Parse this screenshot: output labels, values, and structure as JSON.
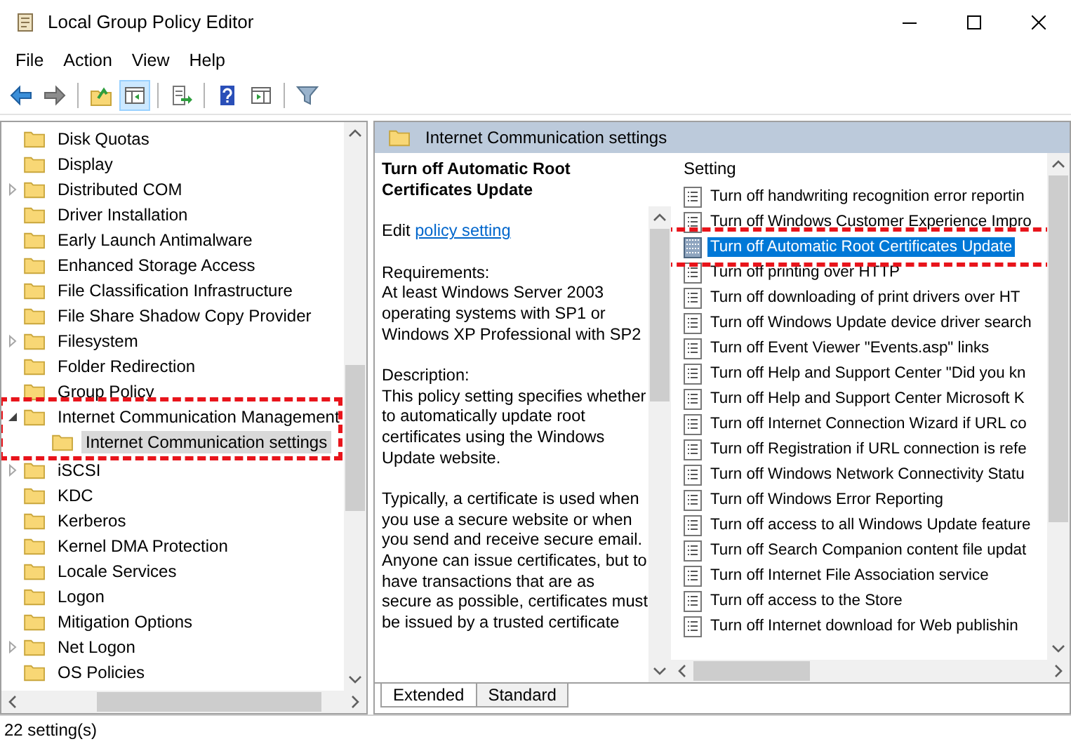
{
  "window": {
    "title": "Local Group Policy Editor"
  },
  "menu": [
    "File",
    "Action",
    "View",
    "Help"
  ],
  "toolbar": [
    {
      "kind": "back",
      "pressed": false
    },
    {
      "kind": "forward",
      "pressed": false
    },
    {
      "kind": "sep"
    },
    {
      "kind": "up",
      "pressed": false
    },
    {
      "kind": "tree",
      "pressed": true
    },
    {
      "kind": "sep"
    },
    {
      "kind": "export",
      "pressed": false
    },
    {
      "kind": "sep"
    },
    {
      "kind": "help",
      "pressed": false
    },
    {
      "kind": "pane",
      "pressed": false
    },
    {
      "kind": "sep"
    },
    {
      "kind": "filter",
      "pressed": false
    }
  ],
  "tree": {
    "items": [
      {
        "label": "Disk Quotas",
        "kind": "leaf",
        "selected": false,
        "highlighted": false
      },
      {
        "label": "Display",
        "kind": "leaf",
        "selected": false,
        "highlighted": false
      },
      {
        "label": "Distributed COM",
        "kind": "collapsed",
        "selected": false,
        "highlighted": false
      },
      {
        "label": "Driver Installation",
        "kind": "leaf",
        "selected": false,
        "highlighted": false
      },
      {
        "label": "Early Launch Antimalware",
        "kind": "leaf",
        "selected": false,
        "highlighted": false
      },
      {
        "label": "Enhanced Storage Access",
        "kind": "leaf",
        "selected": false,
        "highlighted": false
      },
      {
        "label": "File Classification Infrastructure",
        "kind": "leaf",
        "selected": false,
        "highlighted": false
      },
      {
        "label": "File Share Shadow Copy Provider",
        "kind": "leaf",
        "selected": false,
        "highlighted": false
      },
      {
        "label": "Filesystem",
        "kind": "collapsed",
        "selected": false,
        "highlighted": false
      },
      {
        "label": "Folder Redirection",
        "kind": "leaf",
        "selected": false,
        "highlighted": false
      },
      {
        "label": "Group Policy",
        "kind": "leaf",
        "selected": false,
        "highlighted": false
      },
      {
        "label": "Internet Communication Management",
        "kind": "expanded",
        "selected": false,
        "highlighted": true,
        "children": [
          {
            "label": "Internet Communication settings",
            "selected": true,
            "highlighted": false
          }
        ]
      },
      {
        "label": "iSCSI",
        "kind": "collapsed",
        "selected": false,
        "highlighted": false
      },
      {
        "label": "KDC",
        "kind": "leaf",
        "selected": false,
        "highlighted": false
      },
      {
        "label": "Kerberos",
        "kind": "leaf",
        "selected": false,
        "highlighted": false
      },
      {
        "label": "Kernel DMA Protection",
        "kind": "leaf",
        "selected": false,
        "highlighted": false
      },
      {
        "label": "Locale Services",
        "kind": "leaf",
        "selected": false,
        "highlighted": false
      },
      {
        "label": "Logon",
        "kind": "leaf",
        "selected": false,
        "highlighted": false
      },
      {
        "label": "Mitigation Options",
        "kind": "leaf",
        "selected": false,
        "highlighted": false
      },
      {
        "label": "Net Logon",
        "kind": "collapsed",
        "selected": false,
        "highlighted": false
      },
      {
        "label": "OS Policies",
        "kind": "leaf",
        "selected": false,
        "highlighted": false
      }
    ]
  },
  "details": {
    "header": "Internet Communication settings",
    "title": "Turn off Automatic Root Certificates Update",
    "edit_prefix": "Edit",
    "edit_link": "policy setting",
    "requirements_label": "Requirements:",
    "requirements": "At least Windows Server 2003 operating systems with SP1 or Windows XP Professional with SP2",
    "description_label": "Description:",
    "description": "This policy setting specifies whether to automatically update root certificates using the Windows Update website.",
    "description_more": "Typically, a certificate is used when you use a secure website or when you send and receive secure email. Anyone can issue certificates, but to have transactions that are as secure as possible, certificates must be issued by a trusted certificate",
    "tabs": [
      {
        "label": "Extended",
        "selected": true
      },
      {
        "label": "Standard",
        "selected": false
      }
    ]
  },
  "settings": {
    "column": "Setting",
    "rows": [
      {
        "label": "Turn off handwriting recognition error reportin",
        "selected": false,
        "highlighted": false
      },
      {
        "label": "Turn off Windows Customer Experience Impro",
        "selected": false,
        "highlighted": false
      },
      {
        "label": "Turn off Automatic Root Certificates Update",
        "selected": true,
        "highlighted": true
      },
      {
        "label": "Turn off printing over HTTP",
        "selected": false,
        "highlighted": false
      },
      {
        "label": "Turn off downloading of print drivers over HT",
        "selected": false,
        "highlighted": false
      },
      {
        "label": "Turn off Windows Update device driver search",
        "selected": false,
        "highlighted": false
      },
      {
        "label": "Turn off Event Viewer \"Events.asp\" links",
        "selected": false,
        "highlighted": false
      },
      {
        "label": "Turn off Help and Support Center \"Did you kn",
        "selected": false,
        "highlighted": false
      },
      {
        "label": "Turn off Help and Support Center Microsoft K",
        "selected": false,
        "highlighted": false
      },
      {
        "label": "Turn off Internet Connection Wizard if URL co",
        "selected": false,
        "highlighted": false
      },
      {
        "label": "Turn off Registration if URL connection is refe",
        "selected": false,
        "highlighted": false
      },
      {
        "label": "Turn off Windows Network Connectivity Statu",
        "selected": false,
        "highlighted": false
      },
      {
        "label": "Turn off Windows Error Reporting",
        "selected": false,
        "highlighted": false
      },
      {
        "label": "Turn off access to all Windows Update feature",
        "selected": false,
        "highlighted": false
      },
      {
        "label": "Turn off Search Companion content file updat",
        "selected": false,
        "highlighted": false
      },
      {
        "label": "Turn off Internet File Association service",
        "selected": false,
        "highlighted": false
      },
      {
        "label": "Turn off access to the Store",
        "selected": false,
        "highlighted": false
      },
      {
        "label": "Turn off Internet download for Web publishin",
        "selected": false,
        "highlighted": false
      }
    ]
  },
  "status_bar": "22 setting(s)"
}
